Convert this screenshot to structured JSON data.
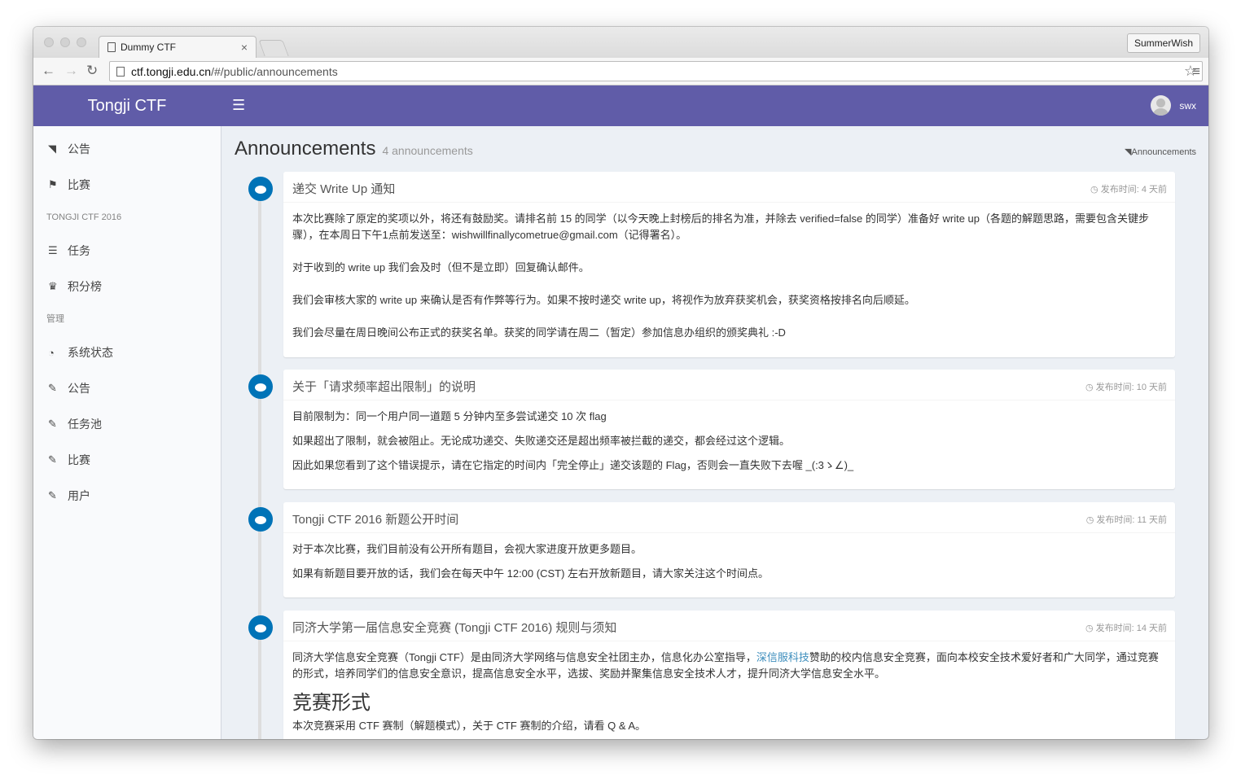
{
  "browser": {
    "tab_title": "Dummy CTF",
    "tab_close": "×",
    "profile_name": "SummerWish",
    "url_host": "ctf.tongji.edu.cn",
    "url_path": "/#/public/announcements"
  },
  "header": {
    "logo": "Tongji CTF",
    "user": "swx"
  },
  "sidebar": {
    "items": [
      {
        "label": "公告",
        "icon": "rss-icon"
      },
      {
        "label": "比赛",
        "icon": "flag-icon"
      }
    ],
    "section1": "TONGJI CTF 2016",
    "items2": [
      {
        "label": "任务",
        "icon": "list-icon"
      },
      {
        "label": "积分榜",
        "icon": "trophy-icon"
      }
    ],
    "section2": "管理",
    "items3": [
      {
        "label": "系统状态",
        "icon": "dashboard-icon"
      },
      {
        "label": "公告",
        "icon": "wrench-icon"
      },
      {
        "label": "任务池",
        "icon": "wrench-icon"
      },
      {
        "label": "比赛",
        "icon": "wrench-icon"
      },
      {
        "label": "用户",
        "icon": "wrench-icon"
      }
    ]
  },
  "page": {
    "title": "Announcements",
    "count": "4 announcements",
    "breadcrumb": "Announcements"
  },
  "announcements": [
    {
      "title": "递交 Write Up 通知",
      "time": "发布时间: 4 天前",
      "paragraphs": [
        "本次比赛除了原定的奖项以外，将还有鼓励奖。请排名前 15 的同学（以今天晚上封榜后的排名为准，并除去 verified=false 的同学）准备好 write up（各题的解题思路，需要包含关键步骤），在本周日下午1点前发送至：wishwillfinallycometrue@gmail.com（记得署名）。",
        "对于收到的 write up 我们会及时（但不是立即）回复确认邮件。",
        "我们会审核大家的 write up 来确认是否有作弊等行为。如果不按时递交 write up，将视作为放弃获奖机会，获奖资格按排名向后顺延。",
        "我们会尽量在周日晚间公布正式的获奖名单。获奖的同学请在周二（暂定）参加信息办组织的颁奖典礼 :-D"
      ]
    },
    {
      "title": "关于「请求频率超出限制」的说明",
      "time": "发布时间: 10 天前",
      "paragraphs": [
        "目前限制为：同一个用户同一道题 5 分钟内至多尝试递交 10 次 flag",
        "如果超出了限制，就会被阻止。无论成功递交、失败递交还是超出频率被拦截的递交，都会经过这个逻辑。",
        "因此如果您看到了这个错误提示，请在它指定的时间内「完全停止」递交该题的 Flag，否则会一直失败下去喔 _(:3ゝ∠)_"
      ]
    },
    {
      "title": "Tongji CTF 2016 新题公开时间",
      "time": "发布时间: 11 天前",
      "paragraphs": [
        "对于本次比赛，我们目前没有公开所有题目，会视大家进度开放更多题目。",
        "如果有新题目要开放的话，我们会在每天中午 12:00 (CST) 左右开放新题目，请大家关注这个时间点。"
      ]
    },
    {
      "title": "同济大学第一届信息安全竞赛 (Tongji CTF 2016) 规则与须知",
      "time": "发布时间: 14 天前",
      "p1_before": "同济大学信息安全竞赛（Tongji CTF）是由同济大学网络与信息安全社团主办，信息化办公室指导，",
      "p1_link": "深信服科技",
      "p1_after": "赞助的校内信息安全竞赛，面向本校安全技术爱好者和广大同学，通过竞赛的形式，培养同学们的信息安全意识，提高信息安全水平，选拔、奖励并聚集信息安全技术人才，提升同济大学信息安全水平。",
      "heading": "竞赛形式",
      "p2": "本次竞赛采用 CTF 赛制（解题模式），关于 CTF 赛制的介绍，请看 Q & A。"
    }
  ],
  "colors": {
    "header": "#605ca8",
    "bubble": "#0073b7",
    "link": "#3c8dbc"
  }
}
